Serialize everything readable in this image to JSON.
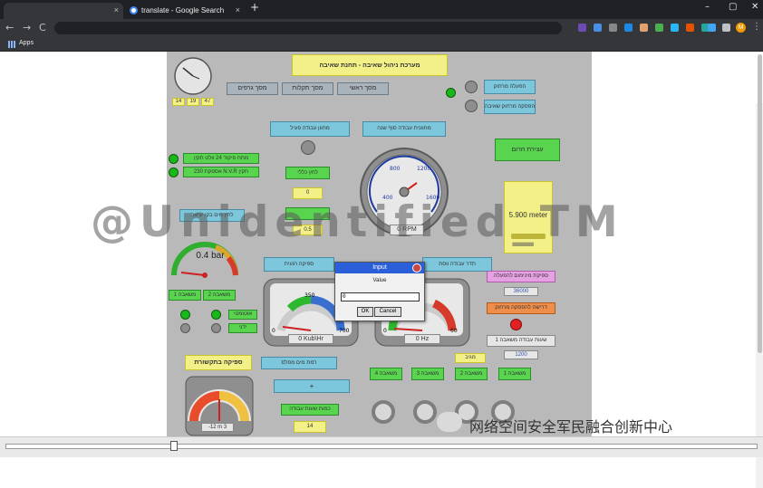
{
  "browser": {
    "tab2_title": "translate - Google Search",
    "new_tab": "+",
    "tab_close": "×",
    "window_min": "–",
    "window_max": "▢",
    "window_close": "✕",
    "back": "←",
    "forward": "→",
    "reload": "C",
    "apps_label": "Apps",
    "profile_initial": "M"
  },
  "scada": {
    "title": "מערכת ניהול שאיבה - תחנת שאיבה",
    "clock_labels": [
      "14",
      "19",
      "47"
    ],
    "nav": [
      "מסך גרפים",
      "מסך תקלות",
      "מסך ראשי"
    ],
    "start_button": "הפעלה מרחוק",
    "stop_button": "הפסקה מרחוק שאיבה",
    "sensors_box": "מחוון עבודה פעיל",
    "work_status": "מחוונית עבודה סוף שנה",
    "alarm_a": "מתח פיקוד 24 וולט תקין",
    "alarm_b": "230 אספקת N.V.R תקין",
    "level_title": "לחץ כללי",
    "level_val": "0",
    "level_val2": "0.5",
    "pressure_btn": "לחץ מים בקו יציאה",
    "pressure_value": "0.4 bar",
    "pump1_label": "משאבה 1",
    "pump2_label": "משאבה 2",
    "auto_label": "אוטומטי",
    "manual_label": "ידני",
    "rpm_value": "0 RPM",
    "rpm_ticks": [
      "400",
      "800",
      "1200",
      "1600"
    ],
    "flow_title": "ספיקה רגעית",
    "flow_value": "0 Kub\\Hr",
    "flow_ticks": [
      "0",
      "350",
      "700"
    ],
    "freq_title": "תדר עבודה ווסת",
    "freq_value": "0 Hz",
    "freq_ticks": [
      "0",
      "60"
    ],
    "level_meter": "5.900 meter",
    "emergency": "עצירת חרום",
    "min_flow_title": "ספיקת מינימום להפעלה",
    "min_flow_value": "36000",
    "remote_request": "דרישה להפסקה מרחוק",
    "pump_runtime": "שעות עבודה משאבה 1",
    "pump_runtime_val": "1200",
    "comm_fault": "ספיקה בתקשורת",
    "water_level_btn": "רמת מים מפלס",
    "plus": "+",
    "yearly": "כמות שעות עבודה",
    "yearly_val": "14",
    "small_gauge": "-12 m 3",
    "status_label": "מגיב",
    "pumps": [
      "משאבה 4",
      "משאבה 3",
      "משאבה 2",
      "משאבה 1"
    ]
  },
  "dialog": {
    "title": "Input",
    "label": "Value",
    "input_value": "0",
    "ok": "OK",
    "cancel": "Cancel"
  },
  "overlay": {
    "watermark": "@Unidentified_TM",
    "wechat_caption": "网络空间安全军民融合创新中心"
  },
  "colors": {
    "dialog_title_bar": "#2b5fd9",
    "indicator_green": "#18b818",
    "indicator_red": "#e22222",
    "panel_bg": "#b9b9b9"
  }
}
